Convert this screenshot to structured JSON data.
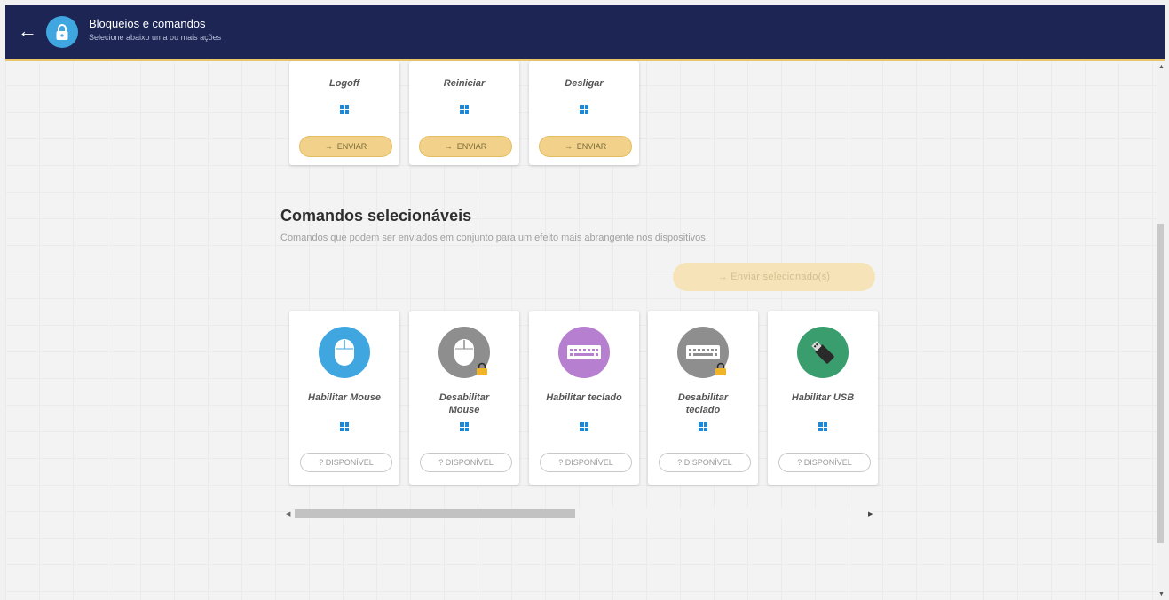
{
  "header": {
    "title": "Bloqueios e comandos",
    "subtitle": "Selecione abaixo uma ou mais ações",
    "back_icon": "arrow-left-icon",
    "badge_icon": "lock-icon",
    "colors": {
      "bar": "#1c2553",
      "accent": "#e9c76c",
      "badge": "#3fa6e0"
    }
  },
  "top_commands": [
    {
      "label": "Logoff",
      "platform_icon": "windows-icon",
      "button": "ENVIAR"
    },
    {
      "label": "Reiniciar",
      "platform_icon": "windows-icon",
      "button": "ENVIAR"
    },
    {
      "label": "Desligar",
      "platform_icon": "windows-icon",
      "button": "ENVIAR"
    }
  ],
  "send_arrow": "→",
  "selectable": {
    "title": "Comandos selecionáveis",
    "description": "Comandos que podem ser enviados em conjunto para um efeito mais abrangente nos dispositivos.",
    "send_selected_label": "→  Enviar selecionado(s)",
    "commands": [
      {
        "label": "Habilitar Mouse",
        "icon": "mouse-icon",
        "icon_color": "#3fa6e0",
        "platform_icon": "windows-icon",
        "button": "? DISPONÍVEL"
      },
      {
        "label": "Desabilitar Mouse",
        "icon": "mouse-locked-icon",
        "icon_color": "#8e8e8e",
        "platform_icon": "windows-icon",
        "button": "? DISPONÍVEL"
      },
      {
        "label": "Habilitar teclado",
        "icon": "keyboard-icon",
        "icon_color": "#b67fcf",
        "platform_icon": "windows-icon",
        "button": "? DISPONÍVEL"
      },
      {
        "label": "Desabilitar teclado",
        "icon": "keyboard-locked-icon",
        "icon_color": "#8e8e8e",
        "platform_icon": "windows-icon",
        "button": "? DISPONÍVEL"
      },
      {
        "label": "Habilitar USB",
        "icon": "usb-icon",
        "icon_color": "#3a9d6e",
        "platform_icon": "windows-icon",
        "button": "? DISPONÍVEL"
      }
    ]
  }
}
